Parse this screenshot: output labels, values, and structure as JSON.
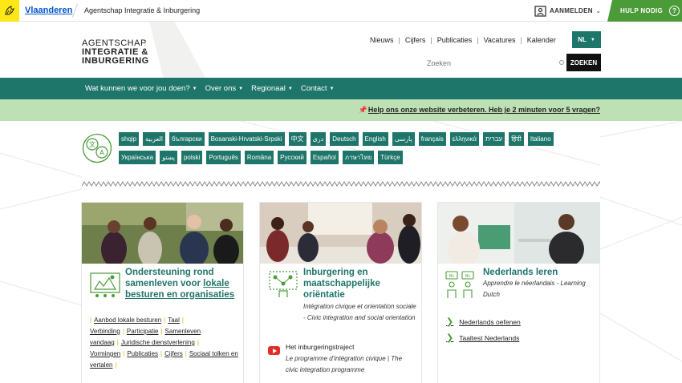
{
  "topbar": {
    "flanders_link": "Vlaanderen",
    "agency_name": "Agentschap Integratie & Inburgering",
    "login_label": "AANMELDEN",
    "help_label": "HULP NODIG",
    "help_icon": "?"
  },
  "header": {
    "logo_lines": [
      "AGENTSCHAP",
      "INTEGRATIE &",
      "INBURGERING"
    ],
    "nav_links": [
      "Nieuws",
      "Cijfers",
      "Publicaties",
      "Vacatures",
      "Kalender"
    ],
    "language": "NL",
    "search_placeholder": "Zoeken",
    "search_button": "ZOEKEN"
  },
  "main_nav": {
    "items": [
      "Wat kunnen we voor jou doen?",
      "Over ons",
      "Regionaal",
      "Contact"
    ]
  },
  "banner": {
    "text": "Help ons onze website verbeteren. Heb je 2 minuten voor 5 vragen?"
  },
  "languages": {
    "row1": [
      "shqip",
      "العربية",
      "български",
      "Bosanski-Hrvatski-Srpski",
      "中文",
      "دری",
      "Deutsch",
      "English",
      "پارسی",
      "français",
      "ελληνικά",
      "עברית",
      "हिंदी",
      "Italiano"
    ],
    "row2": [
      "Українська",
      "پښتو",
      "polski",
      "Português",
      "Româna",
      "Русский",
      "Español",
      "ภาษาไทย",
      "Türkçe"
    ]
  },
  "cards": [
    {
      "title_line1": "Ondersteuning rond",
      "title_line2_plain": "samenleven voor",
      "title_line2_link": "lokale",
      "title_line3_link": "besturen en organisaties",
      "links": [
        "Aanbod lokale besturen",
        "Taal",
        "Verbinding",
        "Participatie",
        "Samenleven vandaag",
        "Juridische dienstverlening",
        "Vormingen",
        "Publicaties",
        "Cijfers",
        "Sociaal tolken en vertalen"
      ]
    },
    {
      "title": [
        "Inburgering en",
        "maatschappelijke",
        "oriëntatie"
      ],
      "subtitle": "Intégration civique et orientation sociale - Civic integration and social orientation",
      "video_title": "Het inburgeringstraject",
      "video_subtitle": "Le programme d'intégration civique | The civic integration programme"
    },
    {
      "title": "Nederlands leren",
      "subtitle": "Apprendre le néerlandais - Learning Dutch",
      "links": [
        "Nederlands oefenen",
        "Taaltest Nederlands"
      ]
    }
  ],
  "colors": {
    "primary_green": "#1e7569",
    "light_green": "#bde0b5",
    "help_green": "#4b9b39",
    "flanders_yellow": "#ffe615"
  }
}
